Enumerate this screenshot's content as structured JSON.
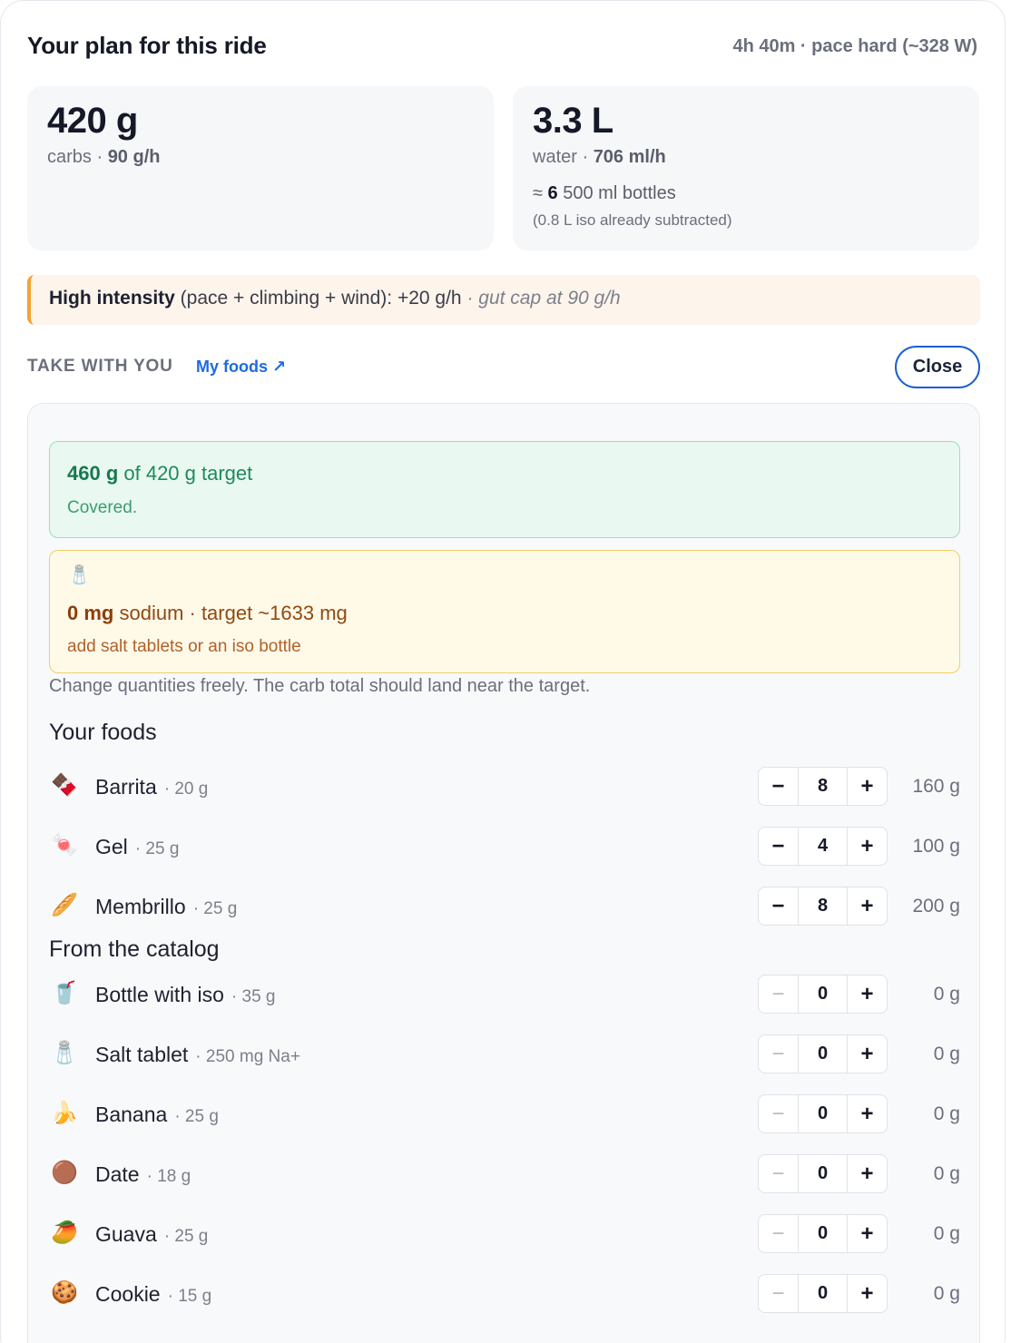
{
  "header": {
    "title": "Your plan for this ride",
    "summary": "4h 40m · pace hard (~328 W)"
  },
  "carbs": {
    "amount": "420 g",
    "label": "carbs · ",
    "rate": "90 g/h"
  },
  "water": {
    "amount": "3.3 L",
    "label": "water · ",
    "rate": "706 ml/h",
    "bottles_prefix": "≈ ",
    "bottles_count": "6",
    "bottles_suffix": " 500 ml bottles",
    "note": "(0.8 L iso already subtracted)"
  },
  "intensity": {
    "strong": "High intensity",
    "text": " (pace + climbing + wind): +20 g/h ",
    "cap": "· gut cap at 90 g/h"
  },
  "section": {
    "label": "TAKE WITH YOU",
    "link": "My foods ↗",
    "close": "Close"
  },
  "coverage": {
    "have": "460 g",
    "rest": " of 420 g target",
    "status": "Covered."
  },
  "sodium": {
    "icon": "🧂",
    "have": "0 mg",
    "rest": " sodium · target ~1633 mg",
    "advice": "add salt tablets or an iso bottle"
  },
  "hint": "Change quantities freely. The carb total should land near the target.",
  "your_foods": {
    "title": "Your foods",
    "items": [
      {
        "icon": "🍫",
        "name": "Barrita",
        "unit": "· 20 g",
        "qty": "8",
        "total": "160 g"
      },
      {
        "icon": "🍬",
        "name": "Gel",
        "unit": "· 25 g",
        "qty": "4",
        "total": "100 g"
      },
      {
        "icon": "🥖",
        "name": "Membrillo",
        "unit": "· 25 g",
        "qty": "8",
        "total": "200 g"
      }
    ]
  },
  "catalog": {
    "title": "From the catalog",
    "items": [
      {
        "icon": "🥤",
        "name": "Bottle with iso",
        "unit": "· 35 g",
        "qty": "0",
        "total": "0 g"
      },
      {
        "icon": "🧂",
        "name": "Salt tablet",
        "unit": "· 250 mg Na+",
        "qty": "0",
        "total": "0 g"
      },
      {
        "icon": "🍌",
        "name": "Banana",
        "unit": "· 25 g",
        "qty": "0",
        "total": "0 g"
      },
      {
        "icon": "🟤",
        "name": "Date",
        "unit": "· 18 g",
        "qty": "0",
        "total": "0 g"
      },
      {
        "icon": "🥭",
        "name": "Guava",
        "unit": "· 25 g",
        "qty": "0",
        "total": "0 g"
      },
      {
        "icon": "🍪",
        "name": "Cookie",
        "unit": "· 15 g",
        "qty": "0",
        "total": "0 g"
      }
    ]
  },
  "stepper": {
    "minus": "−",
    "plus": "+"
  },
  "colors": {
    "accent": "#1d6ae5",
    "success": "#1f8a5d",
    "warning": "#f2a534",
    "sodium_text": "#8f4a12"
  }
}
